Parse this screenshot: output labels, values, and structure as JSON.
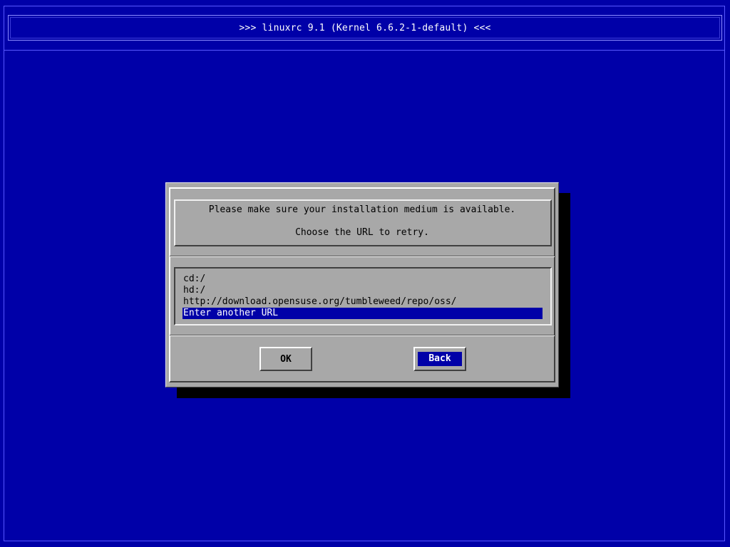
{
  "header": {
    "title": ">>> linuxrc 9.1 (Kernel 6.6.2-1-default) <<<"
  },
  "dialog": {
    "message_line1": "Please make sure your installation medium is available.",
    "message_line2": "Choose the URL to retry.",
    "url_list": [
      {
        "label": "cd:/",
        "selected": false
      },
      {
        "label": "hd:/",
        "selected": false
      },
      {
        "label": "http://download.opensuse.org/tumbleweed/repo/oss/",
        "selected": false
      },
      {
        "label": "Enter another URL",
        "selected": true
      }
    ],
    "buttons": {
      "ok_label": "OK",
      "back_label": "Back",
      "focused": "Back"
    }
  },
  "colors": {
    "background": "#0000a8",
    "dialog": "#a8a8a8",
    "highlight": "#0000a8",
    "text": "#000000",
    "highlight_text": "#ffffff"
  }
}
